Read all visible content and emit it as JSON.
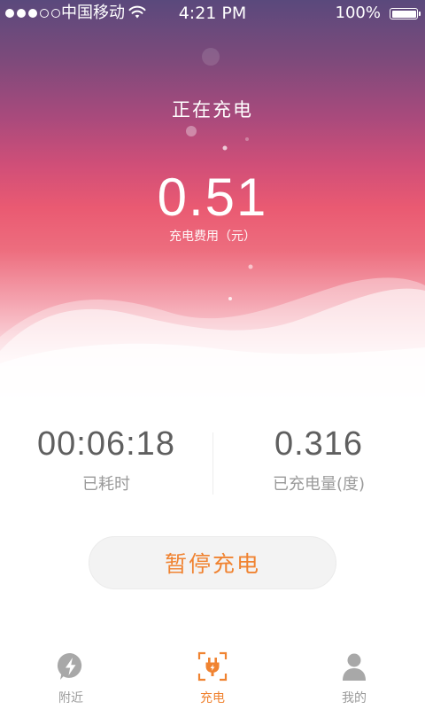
{
  "status_bar": {
    "carrier": "中国移动",
    "time": "4:21 PM",
    "battery": "100%",
    "signal_bars_filled": 3,
    "signal_bars_total": 5
  },
  "charging": {
    "title": "正在充电",
    "fee_value": "0.51",
    "fee_label": "充电费用（元）"
  },
  "stats": {
    "elapsed_value": "00:06:18",
    "elapsed_label": "已耗时",
    "energy_value": "0.316",
    "energy_label": "已充电量(度)"
  },
  "actions": {
    "pause_label": "暂停充电"
  },
  "tabs": [
    {
      "label": "附近",
      "icon": "lightning-pin-icon",
      "active": false
    },
    {
      "label": "充电",
      "icon": "plug-icon",
      "active": true
    },
    {
      "label": "我的",
      "icon": "user-icon",
      "active": false
    }
  ],
  "colors": {
    "accent": "#f08331",
    "gradient_top": "#5a497c",
    "gradient_mid": "#ea5a72",
    "inactive_icon": "#a8a8a8"
  }
}
